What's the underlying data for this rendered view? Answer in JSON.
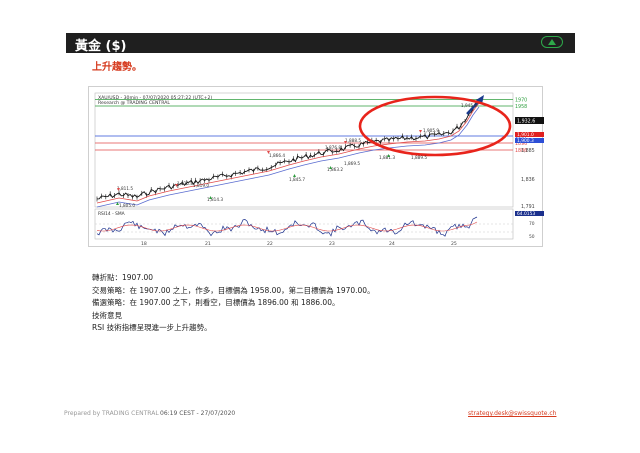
{
  "header": {
    "title": "黃金 ($)"
  },
  "subtitle": "上升趨勢。",
  "chart": {
    "info_line1": "XAU/USD - 30min - 07/07/2020 05:27:22 (UTC+2)",
    "info_line2": "Research @ TRADING CENTRAL",
    "rsi_label": "RSI14 - SMA",
    "price_ticks": [
      "1,885",
      "1,836",
      "1,791"
    ],
    "rsi_ticks": [
      "70",
      "50"
    ],
    "date_ticks": [
      "18",
      "21",
      "22",
      "23",
      "24",
      "25"
    ],
    "level_tags": [
      {
        "text": "1970",
        "color": "#2e9e3e"
      },
      {
        "text": "1958",
        "color": "#2e9e3e"
      },
      {
        "text": "1907",
        "color": "#2d4fd6"
      },
      {
        "text": "1896",
        "color": "#e04a4a"
      },
      {
        "text": "1886",
        "color": "#e04a4a"
      }
    ],
    "price_boxes": {
      "current": "1,932.6",
      "red": "1,901.0",
      "blue": "1,900.3"
    },
    "rsi_value": "64.0153",
    "annotations": [
      "1,811.5",
      "1,805.0",
      "1,820.8",
      "1,819.0",
      "1,814.3",
      "1,866.4",
      "1,845.7",
      "1,876.8",
      "1,863.2",
      "1,888.5",
      "1,869.5",
      "1,881.3",
      "1,889.5",
      "1,905.9",
      "1,945.6"
    ],
    "colors": {
      "highlight_circle": "#e8241b",
      "trend_arrow": "#1a3a8c",
      "support_blue": "#2d4fd6",
      "resistance_green": "#2e9e3e",
      "support_red": "#e04a4a"
    }
  },
  "analysis": {
    "pivot": "轉折點：1907.00",
    "strategy": "交易策略：在 1907.00 之上，作多，目標價為 1958.00，第二目標價為 1970.00。",
    "alternative": "備選策略：在 1907.00 之下，則看空，目標價為 1896.00 和 1886.00。",
    "comment_title": "技術意見",
    "comment": "RSI 技術指標呈現進一步上升趨勢。"
  },
  "footer": {
    "prepared_by": "Prepared by TRADING CENTRAL",
    "time": "06:19 CEST - 27/07/2020",
    "email": "strategy.desk@swissquote.ch"
  }
}
